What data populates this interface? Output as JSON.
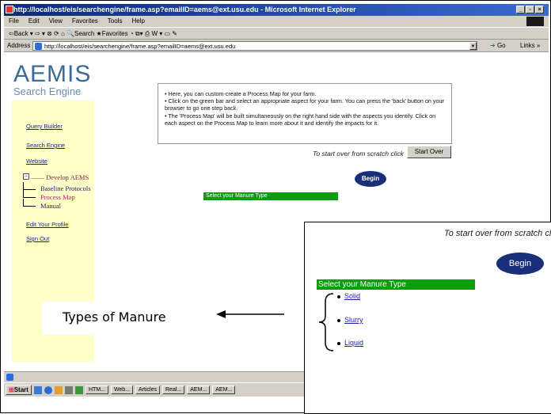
{
  "window": {
    "title": "http://localhost/eis/searchengine/frame.asp?emailID=aems@ext.usu.edu - Microsoft Internet Explorer",
    "menu": [
      "File",
      "Edit",
      "View",
      "Favorites",
      "Tools",
      "Help"
    ],
    "toolbar_text": "⇦Back ▾ ⇨ ▾ ⊗ ⟳ ⌂  🔍Search  ★Favorites  ◔  ⧉▾ ⎙ W ▾ ▭ ✎",
    "address_label": "Address",
    "address_value": "http://localhost/eis/searchengine/frame.asp?emailID=aems@ext.usu.edu",
    "go_label": "Go",
    "links_label": "Links »"
  },
  "sidebar": {
    "logo_title": "AEMIS",
    "logo_subtitle": "Search Engine",
    "links": [
      "Query Builder",
      "Search Engine",
      "Website"
    ],
    "tree_root": "Develop AEMS",
    "tree_items": [
      "Baseline Protocols",
      "Process Map",
      "Manual"
    ],
    "bottom_links": [
      "Edit Your Profile",
      "Sign Out"
    ]
  },
  "info": {
    "bullets": [
      "• Here, you can custom-create a Process Map for your farm.",
      "• Click on the green bar and select an appropriate aspect for your farm. You can press the 'back' button on your browser to go one step back.",
      "• The 'Process Map' will be built simultaneously on the right hand side with the aspects you identify. Click on each aspect on the Process Map to learn more about it and identify the impacts for it."
    ]
  },
  "controls": {
    "start_over_text": "To start over from scratch click",
    "start_over_button": "Start Over",
    "begin_button": "Begin",
    "manure_bar": "Select your Manure Type"
  },
  "taskbar": {
    "start": "Start",
    "tasks": [
      "HTM...",
      "Web...",
      "Articles",
      "Real...",
      "AEM...",
      "AEM..."
    ]
  },
  "zoom": {
    "start_over_text": "To start over from scratch click",
    "begin_button": "Begin",
    "manure_bar": "Select your Manure Type",
    "items": [
      "Solid",
      "Slurry",
      "Liquid"
    ]
  },
  "callout": {
    "text": "Types of Manure"
  },
  "colors": {
    "green_bar": "#0d9c0d",
    "begin_oval": "#1a2f7a",
    "sidebar_bg": "#ffffc8",
    "link": "#1a1ab0"
  }
}
